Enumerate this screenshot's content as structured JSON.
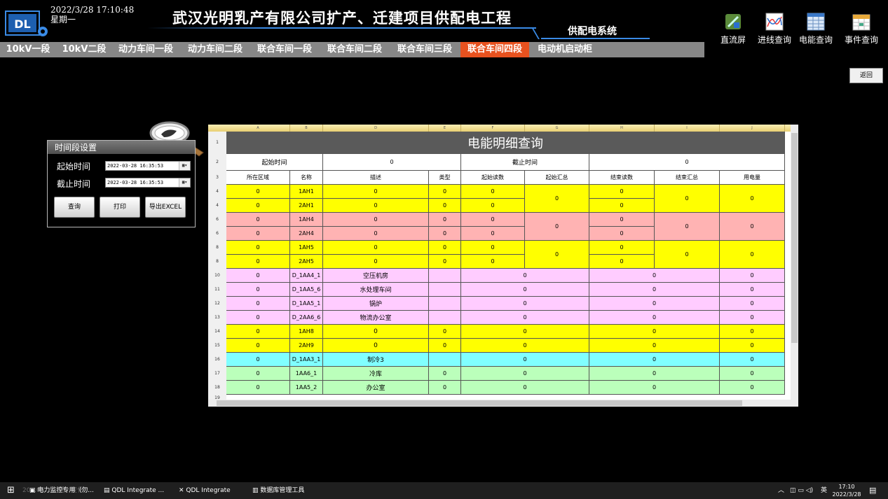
{
  "app": {
    "logo_text": "DL",
    "datetime": "2022/3/28 17:10:48",
    "weekday": "星期一",
    "title": "武汉光明乳产有限公司扩产、迁建项目供配电工程",
    "subtitle": "供配电系统"
  },
  "toolbar": [
    {
      "label": "直流屏",
      "icon": "dc-screen-icon"
    },
    {
      "label": "进线查询",
      "icon": "curve-chart-icon"
    },
    {
      "label": "电能查询",
      "icon": "table-grid-icon"
    },
    {
      "label": "事件查询",
      "icon": "calendar-icon"
    }
  ],
  "tabs": [
    {
      "label": "10kV一段",
      "active": false
    },
    {
      "label": "10kV二段",
      "active": false
    },
    {
      "label": "动力车间一段",
      "active": false
    },
    {
      "label": "动力车间二段",
      "active": false
    },
    {
      "label": "联合车间一段",
      "active": false
    },
    {
      "label": "联合车间二段",
      "active": false
    },
    {
      "label": "联合车间三段",
      "active": false
    },
    {
      "label": "联合车间四段",
      "active": true
    },
    {
      "label": "电动机启动柜",
      "active": false
    }
  ],
  "back_label": "返回",
  "panel": {
    "title": "时间段设置",
    "start_label": "起始时间",
    "end_label": "截止时间",
    "start_value": "2022-03-28 16:35:53",
    "end_value": "2022-03-28 16:35:53",
    "query_label": "查询",
    "print_label": "打印",
    "export_label": "导出EXCEL"
  },
  "sheet": {
    "col_letters": [
      "A",
      "B",
      "D",
      "E",
      "F",
      "G",
      "H",
      "I",
      "J"
    ],
    "title": "电能明细查询",
    "start_time_label": "起始时间",
    "start_time_value": "0",
    "end_time_label": "截止时间",
    "end_time_value": "0",
    "headers": [
      "所在区域",
      "名称",
      "描述",
      "类型",
      "起始读数",
      "起始汇总",
      "结束读数",
      "结束汇总",
      "用电量"
    ],
    "groups": [
      {
        "color": "#ffff00",
        "summary": {
          "start_total": "0",
          "end_total": "0",
          "usage": "0"
        },
        "rows": [
          {
            "area": "0",
            "name": "1AH1",
            "desc": "0",
            "type": "0",
            "start": "0",
            "end": "0"
          },
          {
            "area": "0",
            "name": "2AH1",
            "desc": "0",
            "type": "0",
            "start": "0",
            "end": "0"
          }
        ]
      },
      {
        "color": "#ffb3b3",
        "summary": {
          "start_total": "0",
          "end_total": "0",
          "usage": "0"
        },
        "rows": [
          {
            "area": "0",
            "name": "1AH4",
            "desc": "0",
            "type": "0",
            "start": "0",
            "end": "0"
          },
          {
            "area": "0",
            "name": "2AH4",
            "desc": "0",
            "type": "0",
            "start": "0",
            "end": "0"
          }
        ]
      },
      {
        "color": "#ffff00",
        "summary": {
          "start_total": "0",
          "end_total": "0",
          "usage": "0"
        },
        "rows": [
          {
            "area": "0",
            "name": "1AH5",
            "desc": "0",
            "type": "0",
            "start": "0",
            "end": "0"
          },
          {
            "area": "0",
            "name": "2AH5",
            "desc": "0",
            "type": "0",
            "start": "0",
            "end": "0"
          }
        ]
      }
    ],
    "rows": [
      {
        "area": "0",
        "name": "D_1AA4_1",
        "desc": "空压机房",
        "type": "",
        "start": "0",
        "end": "0",
        "usage": "0",
        "color": "#ffccff"
      },
      {
        "area": "0",
        "name": "D_1AA5_6",
        "desc": "水处理车间",
        "type": "",
        "start": "0",
        "end": "0",
        "usage": "0",
        "color": "#ffccff"
      },
      {
        "area": "0",
        "name": "D_1AA5_1",
        "desc": "锅炉",
        "type": "",
        "start": "0",
        "end": "0",
        "usage": "0",
        "color": "#ffccff"
      },
      {
        "area": "0",
        "name": "D_2AA6_6",
        "desc": "物流办公室",
        "type": "",
        "start": "0",
        "end": "0",
        "usage": "0",
        "color": "#ffccff"
      },
      {
        "area": "0",
        "name": "1AH8",
        "desc": "0",
        "type": "0",
        "start": "0",
        "end": "0",
        "usage": "0",
        "color": "#ffff00"
      },
      {
        "area": "0",
        "name": "2AH9",
        "desc": "0",
        "type": "0",
        "start": "0",
        "end": "0",
        "usage": "0",
        "color": "#ffff00"
      },
      {
        "area": "0",
        "name": "D_1AA3_1",
        "desc": "制冷3",
        "type": "",
        "start": "0",
        "end": "0",
        "usage": "0",
        "color": "#80ffff"
      },
      {
        "area": "0",
        "name": "1AA6_1",
        "desc": "冷库",
        "type": "0",
        "start": "0",
        "end": "0",
        "usage": "0",
        "color": "#bbffbb"
      },
      {
        "area": "0",
        "name": "1AA5_2",
        "desc": "办公室",
        "type": "0",
        "start": "0",
        "end": "0",
        "usage": "0",
        "color": "#bbffbb"
      }
    ],
    "last_row_number": "19"
  },
  "taskbar": {
    "items": [
      "电力监控专用（勿...",
      "QDL Integrate ...",
      "QDL Integrate",
      "数据库管理工具"
    ],
    "overlay_text": "20...05... ...回...变化...",
    "clock_time": "17:10",
    "clock_date": "2022/3/28",
    "tray_lang": "英"
  }
}
